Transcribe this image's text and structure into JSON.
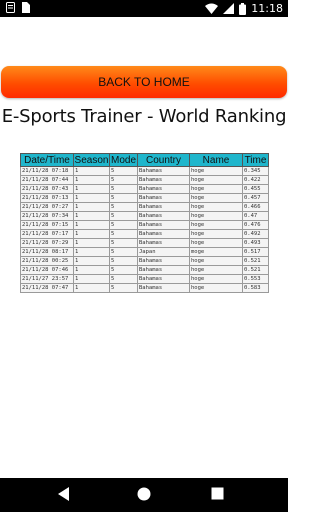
{
  "status_bar": {
    "time": "11:18",
    "icons": [
      "notification-box-icon",
      "sim-card-icon",
      "wifi-icon",
      "signal-icon",
      "battery-icon"
    ]
  },
  "home_button": {
    "label": "BACK TO HOME"
  },
  "page_title": "E-Sports Trainer - World Ranking",
  "colors": {
    "header_bg": "#1fb6cc",
    "button_top": "#ff8a1a",
    "button_bottom": "#ff2a00"
  },
  "table": {
    "headers": [
      "Date/Time",
      "Season",
      "Mode",
      "Country",
      "Name",
      "Time"
    ],
    "rows": [
      [
        "21/11/28 07:18",
        "1",
        "5",
        "Bahamas",
        "hoge",
        "0.345"
      ],
      [
        "21/11/28 07:44",
        "1",
        "5",
        "Bahamas",
        "hoge",
        "0.422"
      ],
      [
        "21/11/28 07:43",
        "1",
        "5",
        "Bahamas",
        "hoge",
        "0.455"
      ],
      [
        "21/11/28 07:13",
        "1",
        "5",
        "Bahamas",
        "hoge",
        "0.457"
      ],
      [
        "21/11/28 07:27",
        "1",
        "5",
        "Bahamas",
        "hoge",
        "0.466"
      ],
      [
        "21/11/28 07:34",
        "1",
        "5",
        "Bahamas",
        "hoge",
        "0.47"
      ],
      [
        "21/11/28 07:15",
        "1",
        "5",
        "Bahamas",
        "hoge",
        "0.476"
      ],
      [
        "21/11/28 07:17",
        "1",
        "5",
        "Bahamas",
        "hoge",
        "0.492"
      ],
      [
        "21/11/28 07:29",
        "1",
        "5",
        "Bahamas",
        "hoge",
        "0.493"
      ],
      [
        "21/11/28 08:17",
        "1",
        "5",
        "Japan",
        "moge",
        "0.517"
      ],
      [
        "21/11/28 00:25",
        "1",
        "5",
        "Bahamas",
        "hoge",
        "0.521"
      ],
      [
        "21/11/28 07:46",
        "1",
        "5",
        "Bahamas",
        "hoge",
        "0.521"
      ],
      [
        "21/11/27 23:57",
        "1",
        "5",
        "Bahamas",
        "hoge",
        "0.553"
      ],
      [
        "21/11/28 07:47",
        "1",
        "5",
        "Bahamas",
        "hoge",
        "0.583"
      ]
    ]
  },
  "nav_bar": {
    "icons": [
      "back-icon",
      "home-icon",
      "recents-icon"
    ]
  }
}
